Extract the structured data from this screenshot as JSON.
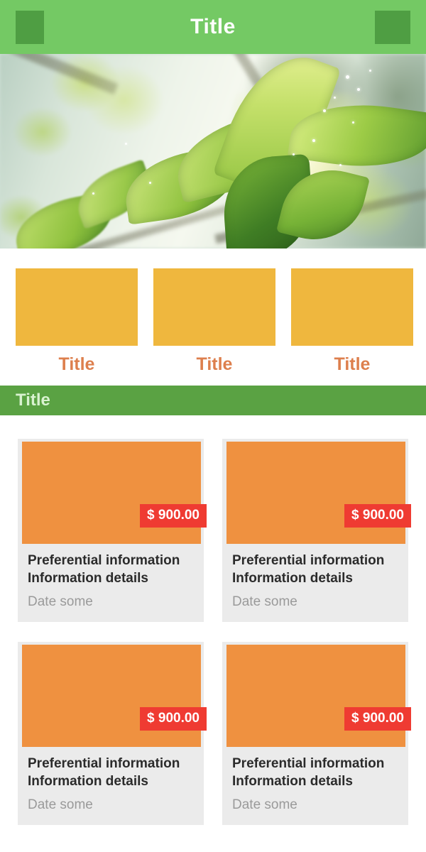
{
  "header": {
    "title": "Title",
    "background_color": "#74c964",
    "square_color": "#4f9e43",
    "title_color": "#ffffff",
    "left_block_name": "logo-block",
    "right_block_name": "menu-block"
  },
  "hero": {
    "alt": "sunlit-green-leaves-photo",
    "name": "hero-banner-image"
  },
  "tiles": {
    "box_color": "#efb73e",
    "label_color": "#dd7f4d",
    "items": [
      {
        "label": "Title"
      },
      {
        "label": "Title"
      },
      {
        "label": "Title"
      }
    ]
  },
  "section": {
    "title": "Title",
    "background_color": "#5aa243",
    "title_color": "#d9f2d0"
  },
  "cards": {
    "media_color": "#ef9140",
    "badge_color": "#ef3b32",
    "card_background": "#ebebeb",
    "items": [
      {
        "price": "$ 900.00",
        "title_line1": "Preferential information",
        "title_line2": "Information details",
        "date": "Date some"
      },
      {
        "price": "$ 900.00",
        "title_line1": "Preferential information",
        "title_line2": "Information details",
        "date": "Date some"
      },
      {
        "price": "$ 900.00",
        "title_line1": "Preferential information",
        "title_line2": "Information details",
        "date": "Date some"
      },
      {
        "price": "$ 900.00",
        "title_line1": "Preferential information",
        "title_line2": "Information details",
        "date": "Date some"
      }
    ]
  }
}
